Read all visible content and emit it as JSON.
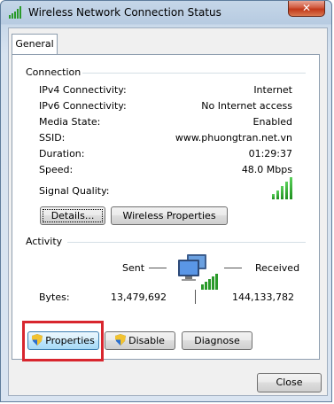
{
  "window": {
    "title": "Wireless Network Connection Status",
    "close_glyph": "✕"
  },
  "tabs": [
    {
      "label": "General"
    }
  ],
  "connection": {
    "heading": "Connection",
    "rows": [
      {
        "label": "IPv4 Connectivity:",
        "value": "Internet"
      },
      {
        "label": "IPv6 Connectivity:",
        "value": "No Internet access"
      },
      {
        "label": "Media State:",
        "value": "Enabled"
      },
      {
        "label": "SSID:",
        "value": "www.phuongtran.net.vn"
      },
      {
        "label": "Duration:",
        "value": "01:29:37"
      },
      {
        "label": "Speed:",
        "value": "48.0 Mbps"
      }
    ],
    "signal_label": "Signal Quality:",
    "signal_bars": 5,
    "details_button": "Details...",
    "wireless_properties_button": "Wireless Properties"
  },
  "activity": {
    "heading": "Activity",
    "sent_label": "Sent",
    "received_label": "Received",
    "bytes_label": "Bytes:",
    "bytes_sent": "13,479,692",
    "bytes_received": "144,133,782"
  },
  "actions": {
    "properties": "Properties",
    "disable": "Disable",
    "diagnose": "Diagnose"
  },
  "footer": {
    "close": "Close"
  },
  "colors": {
    "signal_green": "#1e8f1e",
    "highlight_red": "#d8262e",
    "window_frame": "#5e7c9c"
  }
}
